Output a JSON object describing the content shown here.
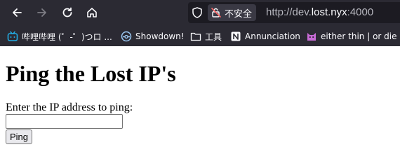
{
  "browser": {
    "insecure_label": "不安全",
    "url_prefix": "http://dev.",
    "url_host": "lost.nyx",
    "url_port": ":4000",
    "bookmarks": [
      {
        "label": "哔哩哔哩 (゜-゜)つロ ...",
        "icon": "bilibili-icon"
      },
      {
        "label": "Showdown!",
        "icon": "showdown-icon"
      },
      {
        "label": "工具",
        "icon": "folder-icon"
      },
      {
        "label": "Annunciation",
        "icon": "notion-icon"
      },
      {
        "label": "either thin | or die",
        "icon": "cat-icon"
      }
    ]
  },
  "page": {
    "title": "Ping the Lost IP's",
    "prompt": "Enter the IP address to ping:",
    "input_value": "",
    "button_label": "Ping"
  }
}
